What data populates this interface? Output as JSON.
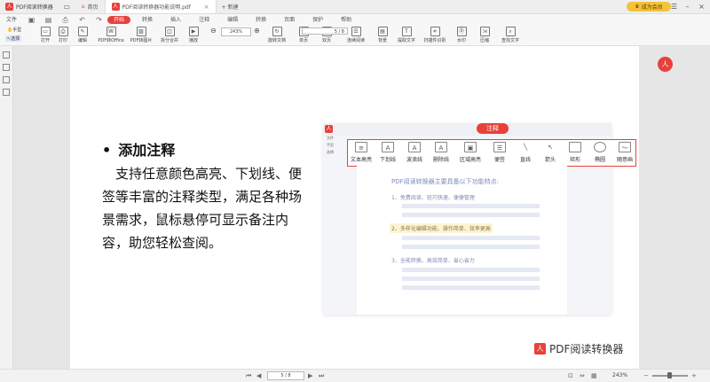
{
  "titlebar": {
    "app_name": "PDF阅读转换器",
    "tabs": [
      {
        "label": "首页"
      },
      {
        "label": "PDF阅读转换器功能说明.pdf"
      }
    ],
    "new_tab": "+ 新建",
    "vip_label": "成为会员"
  },
  "menu": {
    "file": "文件",
    "items": [
      "开始",
      "转换",
      "插入",
      "注释",
      "编辑",
      "转换",
      "页面",
      "保护",
      "帮助"
    ]
  },
  "toolbar": {
    "hand": "手型",
    "select": "选择",
    "tools": [
      "打开",
      "打印",
      "编辑",
      "PDF转Office",
      "PDF转图片",
      "拆分合并",
      "播放",
      "旋转文档",
      "单页",
      "双页",
      "连续阅读",
      "背景",
      "提取文字",
      "扫描件识别",
      "水印",
      "压缩",
      "查找文字"
    ],
    "zoom": "243%",
    "page": "5 / 8"
  },
  "doc": {
    "heading": "添加注释",
    "body": "支持任意颜色高亮、下划线、便签等丰富的注释类型，满足各种场景需求，鼠标悬停可显示备注内容，助您轻松查阅。",
    "footer_logo": "PDF阅读转换器"
  },
  "preview": {
    "badge": "注释",
    "left_items": [
      "文件",
      "手型",
      "选择"
    ],
    "tools": [
      {
        "label": "文本高亮",
        "icon": "text-highlight-icon"
      },
      {
        "label": "下划线",
        "icon": "underline-icon"
      },
      {
        "label": "波浪线",
        "icon": "wavy-line-icon"
      },
      {
        "label": "删除线",
        "icon": "strikethrough-icon"
      },
      {
        "label": "区域高亮",
        "icon": "area-highlight-icon"
      },
      {
        "label": "便签",
        "icon": "sticky-note-icon"
      },
      {
        "label": "直线",
        "icon": "line-icon"
      },
      {
        "label": "箭头",
        "icon": "arrow-icon"
      },
      {
        "label": "矩形",
        "icon": "rectangle-icon"
      },
      {
        "label": "椭圆",
        "icon": "ellipse-icon"
      },
      {
        "label": "随意画",
        "icon": "freehand-icon"
      }
    ],
    "page_title": "PDF阅读转换器主要具备以下功能特点:",
    "list": [
      "1、免费阅读、轻巧快速、便捷管理",
      "2、多样化编辑功能、操作简单、效率更高",
      "3、全能转换、高效简单、省心省力"
    ]
  },
  "statusbar": {
    "page": "5 / 8",
    "zoom": "243%"
  },
  "colors": {
    "accent": "#e8413a",
    "vip": "#f5c23a"
  }
}
